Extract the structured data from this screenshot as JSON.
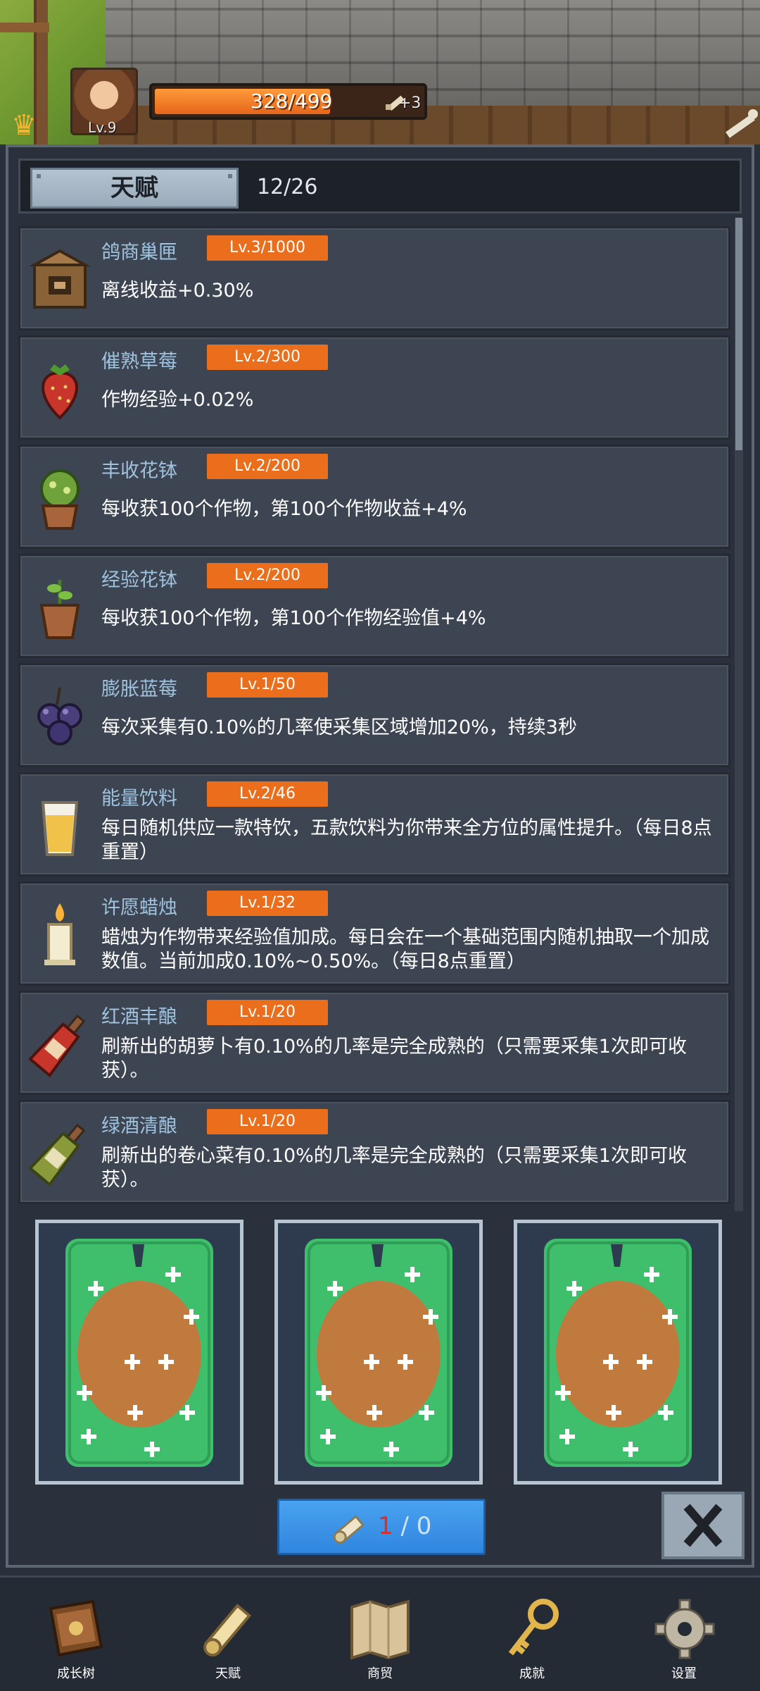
{
  "hud": {
    "player_level": "Lv.9",
    "xp_text": "328/499",
    "xp_progress": 0.657,
    "scroll_bonus": "+3"
  },
  "panel": {
    "tab_label": "天赋",
    "talent_count": "12/26"
  },
  "talents": [
    {
      "icon": "pigeon-box-icon",
      "name": "鸽商巢匣",
      "level": "Lv.3/1000",
      "desc": "离线收益+0.30%"
    },
    {
      "icon": "strawberry-icon",
      "name": "催熟草莓",
      "level": "Lv.2/300",
      "desc": "作物经验+0.02%"
    },
    {
      "icon": "flower-pot-icon",
      "name": "丰收花钵",
      "level": "Lv.2/200",
      "desc": "每收获100个作物，第100个作物收益+4%"
    },
    {
      "icon": "sprout-pot-icon",
      "name": "经验花钵",
      "level": "Lv.2/200",
      "desc": "每收获100个作物，第100个作物经验值+4%"
    },
    {
      "icon": "blueberry-icon",
      "name": "膨胀蓝莓",
      "level": "Lv.1/50",
      "desc": "每次采集有0.10%的几率使采集区域增加20%，持续3秒"
    },
    {
      "icon": "drink-cup-icon",
      "name": "能量饮料",
      "level": "Lv.2/46",
      "desc": "每日随机供应一款特饮，五款饮料为你带来全方位的属性提升。（每日8点重置）"
    },
    {
      "icon": "candle-icon",
      "name": "许愿蜡烛",
      "level": "Lv.1/32",
      "desc": "蜡烛为作物带来经验值加成。每日会在一个基础范围内随机抽取一个加成数值。当前加成0.10%~0.50%。（每日8点重置）"
    },
    {
      "icon": "red-wine-icon",
      "name": "红酒丰酿",
      "level": "Lv.1/20",
      "desc": "刷新出的胡萝卜有0.10%的几率是完全成熟的（只需要采集1次即可收获）。"
    },
    {
      "icon": "green-wine-icon",
      "name": "绿酒清酿",
      "level": "Lv.1/20",
      "desc": "刷新出的卷心菜有0.10%的几率是完全成熟的（只需要采集1次即可收获）。"
    }
  ],
  "claim": {
    "current": "1",
    "separator": " / ",
    "total": "0"
  },
  "nav": [
    {
      "icon": "book-icon",
      "label": "成长树"
    },
    {
      "icon": "scroll-icon",
      "label": "天赋"
    },
    {
      "icon": "map-icon",
      "label": "商贸"
    },
    {
      "icon": "key-icon",
      "label": "成就"
    },
    {
      "icon": "gear-icon",
      "label": "设置"
    }
  ],
  "colors": {
    "badge": "#ea6e1b",
    "talent_name": "#9fc3de",
    "card_green": "#3fbf6b",
    "claim_blue": "#3a94e8"
  }
}
